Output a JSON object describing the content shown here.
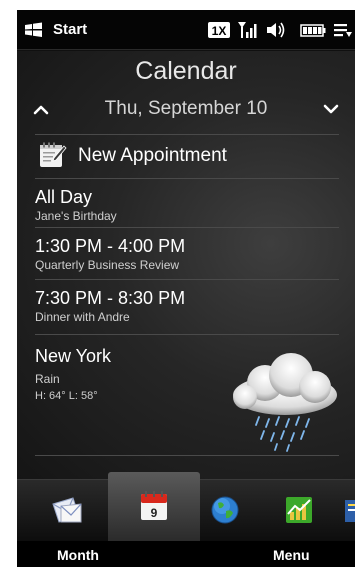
{
  "statusbar": {
    "start_label": "Start",
    "network_badge": "1X",
    "icons": [
      "windows-logo-icon",
      "1x-network-icon",
      "signal-strength-icon",
      "speaker-icon",
      "battery-icon",
      "notification-lines-icon"
    ]
  },
  "header": {
    "title": "Calendar",
    "date": "Thu, September 10"
  },
  "new_appointment": {
    "label": "New Appointment",
    "icon": "notepad-pen-icon"
  },
  "appointments": [
    {
      "time": "All Day",
      "subject": "Jane's Birthday"
    },
    {
      "time": "1:30 PM - 4:00 PM",
      "subject": "Quarterly Business Review"
    },
    {
      "time": "7:30 PM - 8:30 PM",
      "subject": "Dinner with Andre"
    }
  ],
  "weather": {
    "city": "New York",
    "condition": "Rain",
    "temps": "H: 64° L: 58°",
    "icon": "rain-cloud-icon"
  },
  "tabs": {
    "calendar_day": "9",
    "items": [
      "mail-icon",
      "calendar-icon",
      "internet-globe-icon",
      "stocks-chart-icon",
      "more-icon"
    ]
  },
  "softkeys": {
    "left": "Month",
    "right": "Menu"
  },
  "colors": {
    "background": "#101010",
    "text": "#ffffff",
    "subtext": "#cfcfcf",
    "calendar_red": "#d8281c",
    "stocks_green": "#3ca82a"
  }
}
